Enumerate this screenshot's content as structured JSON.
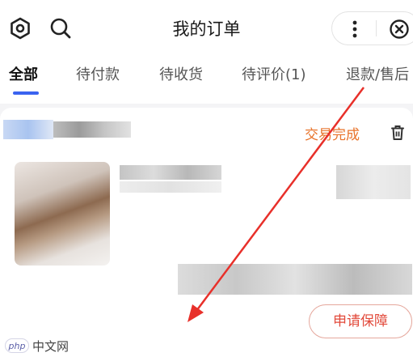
{
  "header": {
    "title": "我的订单",
    "icons": [
      "settings-hexagon-icon",
      "search-icon",
      "more-vertical-icon",
      "close-circle-icon"
    ]
  },
  "tabs": [
    {
      "label": "全部",
      "active": true
    },
    {
      "label": "待付款",
      "active": false
    },
    {
      "label": "待收货",
      "active": false
    },
    {
      "label": "待评价(1)",
      "active": false
    },
    {
      "label": "退款/售后",
      "active": false
    }
  ],
  "order": {
    "status": "交易完成",
    "action_label": "申请保障"
  },
  "colors": {
    "accent_tab": "#3a63f0",
    "status_orange": "#e8742c",
    "button_red": "#e2493a",
    "annotation_red": "#e8302a"
  },
  "watermark": {
    "logo_text": "php",
    "site_text": "中文网"
  }
}
